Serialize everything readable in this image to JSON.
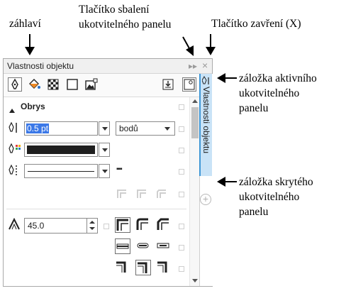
{
  "annotations": {
    "header": "záhlaví",
    "collapse_line1": "Tlačítko sbalení",
    "collapse_line2": "ukotvitelného panelu",
    "close": "Tlačítko zavření (X)",
    "active_tab_line1": "záložka aktivního",
    "active_tab_line2": "ukotvitelného",
    "active_tab_line3": "panelu",
    "hidden_tab_line1": "záložka skrytého",
    "hidden_tab_line2": "ukotvitelného",
    "hidden_tab_line3": "panelu"
  },
  "docker": {
    "title": "Vlastnosti objektu",
    "collapse_glyph": "▸▸",
    "close_glyph": "×",
    "section_title": "Obrys",
    "width_value": "0.5 pt",
    "units_value": "bodů",
    "miter_value": "45.0",
    "dash_glyph": "▪▪▪",
    "tab_label": "Vlastnosti objektu",
    "add_tab_glyph": "+"
  },
  "colors": {
    "active_tab_bg": "#c9e3f7",
    "active_tab_accent": "#3f97d6",
    "selection": "#3b78e7"
  },
  "icons": [
    "outline-pen-icon",
    "fill-icon",
    "transparency-icon",
    "frame-icon",
    "bitmap-icon",
    "wrap-text-icon",
    "properties-icon"
  ]
}
